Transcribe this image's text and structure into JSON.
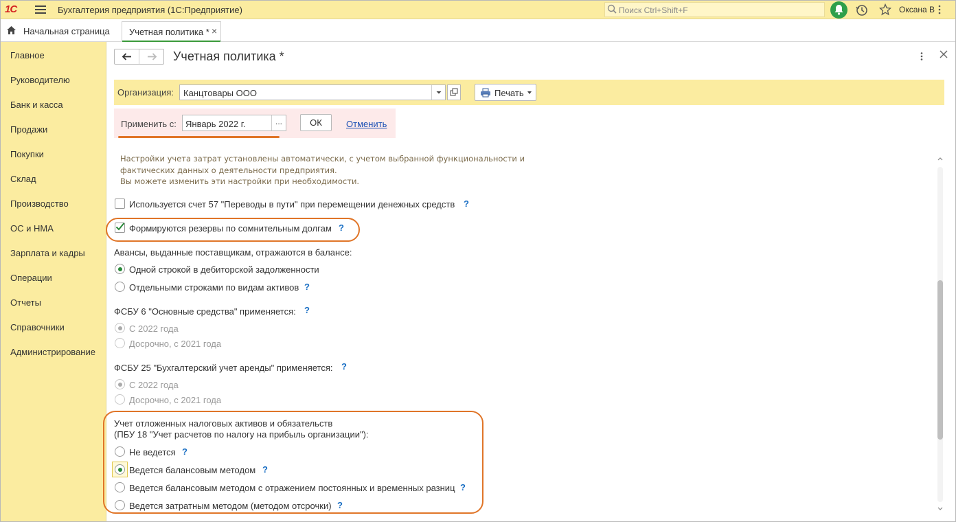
{
  "app": {
    "logo": "1С",
    "title": "Бухгалтерия предприятия  (1С:Предприятие)",
    "search_placeholder": "Поиск Ctrl+Shift+F",
    "user": "Оксана В"
  },
  "tabs": {
    "home_label": "Начальная страница",
    "active_label": "Учетная политика *",
    "close_glyph": "×"
  },
  "sidebar": {
    "items": [
      "Главное",
      "Руководителю",
      "Банк и касса",
      "Продажи",
      "Покупки",
      "Склад",
      "Производство",
      "ОС и НМА",
      "Зарплата и кадры",
      "Операции",
      "Отчеты",
      "Справочники",
      "Администрирование"
    ]
  },
  "form": {
    "title": "Учетная политика *",
    "org_label": "Организация:",
    "org_value": "Канцтовары ООО",
    "print_label": "Печать",
    "apply_label": "Применить с:",
    "apply_value": "Январь 2022 г.",
    "picker_glyph": "...",
    "ok_label": "ОК",
    "cancel_label": "Отменить",
    "info_lines": [
      "Настройки учета затрат установлены автоматически, с учетом выбранной функциональности и",
      "фактических данных о деятельности предприятия.",
      "Вы можете изменить эти настройки при необходимости."
    ],
    "help_glyph": "?",
    "transit_account_label": "Используется счет 57 \"Переводы в пути\" при перемещении денежных средств",
    "reserves_label": "Формируются резервы по сомнительным долгам",
    "advances_heading": "Авансы, выданные поставщикам, отражаются в балансе:",
    "advances_options": [
      "Одной строкой в дебиторской задолженности",
      "Отдельными строками по видам активов"
    ],
    "fsbu6_heading": "ФСБУ 6 \"Основные средства\" применяется:",
    "fsbu6_options": [
      "С 2022 года",
      "Досрочно, с 2021 года"
    ],
    "fsbu25_heading": "ФСБУ 25 \"Бухгалтерский учет аренды\" применяется:",
    "fsbu25_options": [
      "С 2022 года",
      "Досрочно, с 2021 года"
    ],
    "deferred_heading_1": "Учет отложенных налоговых активов и обязательств",
    "deferred_heading_2": "(ПБУ 18 \"Учет расчетов по налогу на прибыль организации\"):",
    "deferred_options": [
      "Не ведется",
      "Ведется балансовым методом",
      "Ведется балансовым методом с отражением постоянных и временных разниц",
      "Ведется затратным методом (методом отсрочки)"
    ]
  },
  "state": {
    "transit_account_checked": false,
    "reserves_checked": true,
    "advances_selected": 0,
    "fsbu6_selected": 0,
    "fsbu25_selected": 0,
    "deferred_selected": 1
  },
  "colors": {
    "accent_green": "#2e9f4a",
    "panel_yellow": "#fbeca0",
    "highlight_orange": "#e07528",
    "link_blue": "#1a4fb4"
  },
  "icons": [
    "hamburger-icon",
    "search-icon",
    "bell-icon",
    "history-icon",
    "star-icon",
    "home-icon",
    "arrow-left-icon",
    "arrow-right-icon",
    "more-vertical-icon",
    "close-icon",
    "printer-icon",
    "open-icon"
  ]
}
